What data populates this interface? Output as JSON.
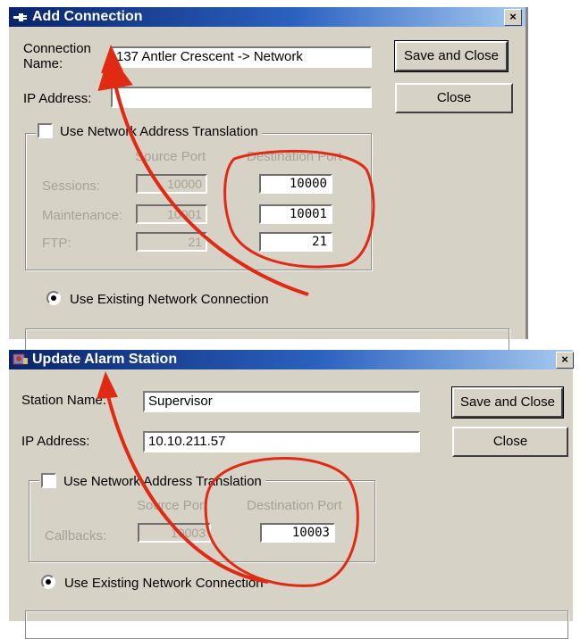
{
  "colors": {
    "title_gradient_start": "#0a246a",
    "title_gradient_end": "#a6caf0",
    "dialog_bg": "#d7d2c6",
    "annotation": "#e02a14"
  },
  "dialog1": {
    "title": "Add Connection",
    "title_icon": "connection-plug-icon",
    "close_glyph": "×",
    "connection_name_label": "Connection Name:",
    "connection_name_value": "137 Antler Crescent -> Network",
    "ip_label": "IP Address:",
    "ip_value": "",
    "save_close_label": "Save and Close",
    "close_label": "Close",
    "nat_label": "Use Network Address Translation",
    "source_port_header": "Source Port",
    "dest_port_header": "Destination Port",
    "rows": [
      {
        "label": "Sessions:",
        "source": "10000",
        "dest": "10000"
      },
      {
        "label": "Maintenance:",
        "source": "10001",
        "dest": "10001"
      },
      {
        "label": "FTP:",
        "source": "21",
        "dest": "21"
      }
    ],
    "existing_conn_label": "Use Existing Network Connection"
  },
  "dialog2": {
    "title": "Update Alarm Station",
    "title_icon": "alarm-station-icon",
    "close_glyph": "×",
    "station_name_label": "Station Name:",
    "station_name_value": "Supervisor",
    "ip_label": "IP Address:",
    "ip_value": "10.10.211.57",
    "save_close_label": "Save and Close",
    "close_label": "Close",
    "nat_label": "Use Network Address Translation",
    "source_port_header": "Source Port",
    "dest_port_header": "Destination Port",
    "rows": [
      {
        "label": "Callbacks:",
        "source": "10003",
        "dest": "10003"
      }
    ],
    "existing_conn_label": "Use Existing Network Connection"
  }
}
